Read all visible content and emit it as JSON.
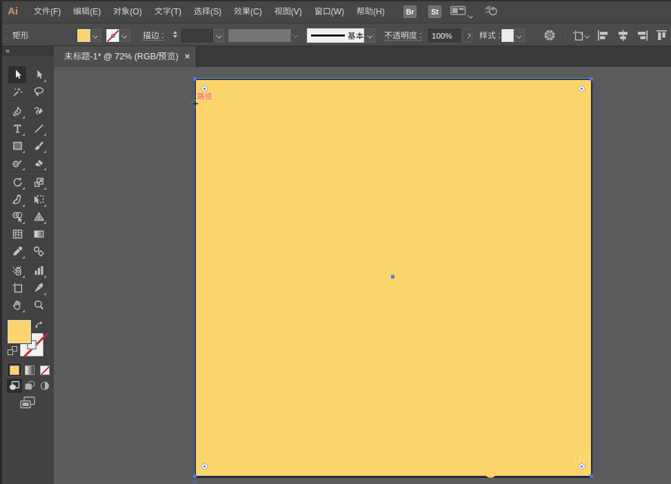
{
  "app": {
    "logo": "Ai"
  },
  "menubar": {
    "items": [
      "文件(F)",
      "编辑(E)",
      "对象(O)",
      "文字(T)",
      "选择(S)",
      "效果(C)",
      "视图(V)",
      "窗口(W)",
      "帮助(H)"
    ],
    "item_names": [
      "file",
      "edit",
      "object",
      "type",
      "select",
      "effect",
      "view",
      "window",
      "help"
    ],
    "bridge": "Br",
    "stock": "St"
  },
  "controlbar": {
    "selection_label": "矩形",
    "stroke_label": "描边 :",
    "profile_name": "基本",
    "opacity_label": "不透明度 :",
    "opacity_value": "100%",
    "style_label": "样式 :"
  },
  "tabbar": {
    "title": "未标题-1* @ 72% (RGB/预览)",
    "close": "×"
  },
  "toolbar": {
    "collapse": "«",
    "tools": [
      {
        "name": "selection",
        "active": true
      },
      {
        "name": "direct-selection",
        "flyout": true
      },
      {
        "name": "magic-wand"
      },
      {
        "name": "lasso",
        "sep_after": true
      },
      {
        "name": "pen",
        "flyout": true
      },
      {
        "name": "curvature"
      },
      {
        "name": "type",
        "flyout": true
      },
      {
        "name": "line-segment",
        "flyout": true
      },
      {
        "name": "rectangle",
        "flyout": true
      },
      {
        "name": "paintbrush",
        "flyout": true
      },
      {
        "name": "shaper",
        "flyout": true
      },
      {
        "name": "eraser",
        "flyout": true,
        "sep_after": true
      },
      {
        "name": "rotate",
        "flyout": true
      },
      {
        "name": "scale",
        "flyout": true
      },
      {
        "name": "width",
        "flyout": true
      },
      {
        "name": "free-transform",
        "flyout": true
      },
      {
        "name": "shape-builder",
        "flyout": true
      },
      {
        "name": "perspective-grid",
        "flyout": true
      },
      {
        "name": "mesh"
      },
      {
        "name": "gradient"
      },
      {
        "name": "eyedropper",
        "flyout": true
      },
      {
        "name": "blend",
        "sep_after": true
      },
      {
        "name": "symbol-sprayer",
        "flyout": true
      },
      {
        "name": "column-graph",
        "flyout": true
      },
      {
        "name": "artboard"
      },
      {
        "name": "slice",
        "flyout": true
      },
      {
        "name": "hand",
        "flyout": true
      },
      {
        "name": "zoom"
      }
    ]
  },
  "canvas": {
    "selection_label": "路径"
  },
  "colors": {
    "artboard_fill": "#fcd46c",
    "selection_blue": "#4e7ce0",
    "smart_guide_pink": "#ef4fa0",
    "canvas_bg": "#5b5b5b"
  }
}
